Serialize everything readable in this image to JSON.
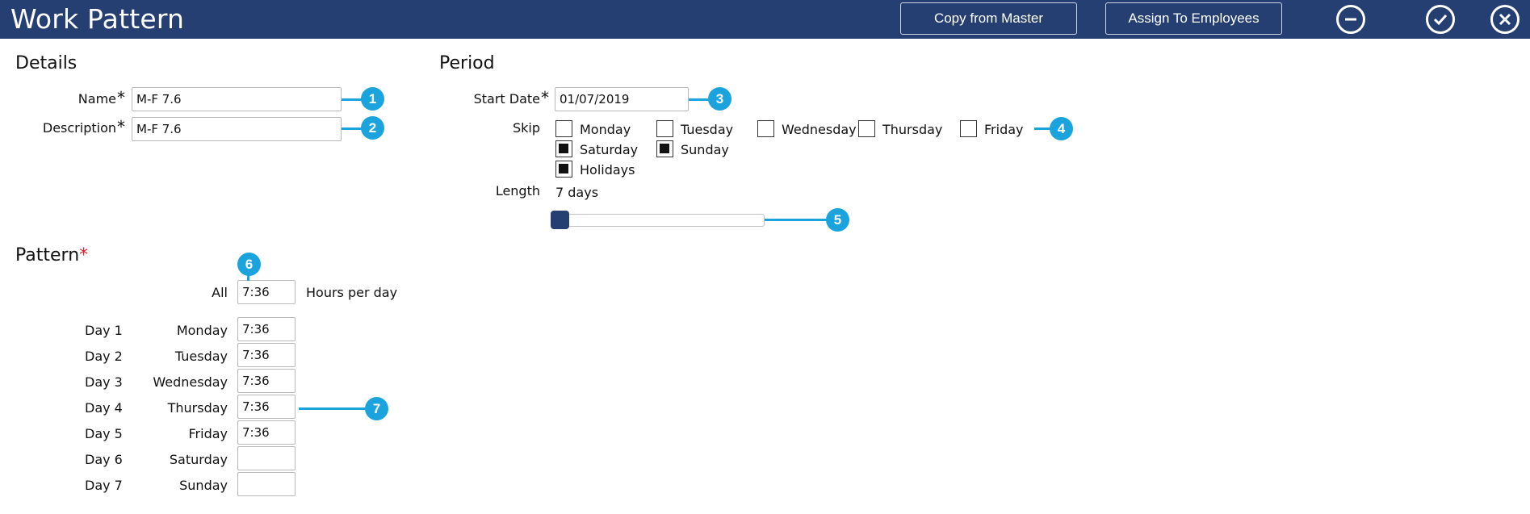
{
  "window": {
    "title": "Work Pattern",
    "buttons": {
      "copy_from_master": "Copy from Master",
      "assign_to_employees": "Assign To Employees"
    },
    "icons": {
      "minimize": "minus-circle-icon",
      "confirm": "check-circle-icon",
      "close": "close-circle-icon"
    }
  },
  "details": {
    "heading": "Details",
    "name_label": "Name",
    "name_value": "M-F 7.6",
    "description_label": "Description",
    "description_value": "M-F 7.6",
    "required_mark": "*"
  },
  "period": {
    "heading": "Period",
    "start_date_label": "Start Date",
    "start_date_value": "01/07/2019",
    "skip_label": "Skip",
    "skip_options": [
      {
        "label": "Monday",
        "checked": false
      },
      {
        "label": "Tuesday",
        "checked": false
      },
      {
        "label": "Wednesday",
        "checked": false
      },
      {
        "label": "Thursday",
        "checked": false
      },
      {
        "label": "Friday",
        "checked": false
      },
      {
        "label": "Saturday",
        "checked": true
      },
      {
        "label": "Sunday",
        "checked": true
      },
      {
        "label": "Holidays",
        "checked": true
      }
    ],
    "length_label": "Length",
    "length_value": "7 days",
    "slider_fraction": 0
  },
  "pattern": {
    "heading": "Pattern",
    "all_label": "All",
    "all_value": "7:36",
    "hours_per_day_label": "Hours per day",
    "days": [
      {
        "day": "Day 1",
        "weekday": "Monday",
        "value": "7:36"
      },
      {
        "day": "Day 2",
        "weekday": "Tuesday",
        "value": "7:36"
      },
      {
        "day": "Day 3",
        "weekday": "Wednesday",
        "value": "7:36"
      },
      {
        "day": "Day 4",
        "weekday": "Thursday",
        "value": "7:36"
      },
      {
        "day": "Day 5",
        "weekday": "Friday",
        "value": "7:36"
      },
      {
        "day": "Day 6",
        "weekday": "Saturday",
        "value": ""
      },
      {
        "day": "Day 7",
        "weekday": "Sunday",
        "value": ""
      }
    ]
  },
  "callouts": [
    "1",
    "2",
    "3",
    "4",
    "5",
    "6",
    "7"
  ],
  "colors": {
    "title_bar": "#263f73",
    "callout": "#1aa3dd",
    "required": "#d9222a",
    "slider_thumb": "#263f73"
  }
}
